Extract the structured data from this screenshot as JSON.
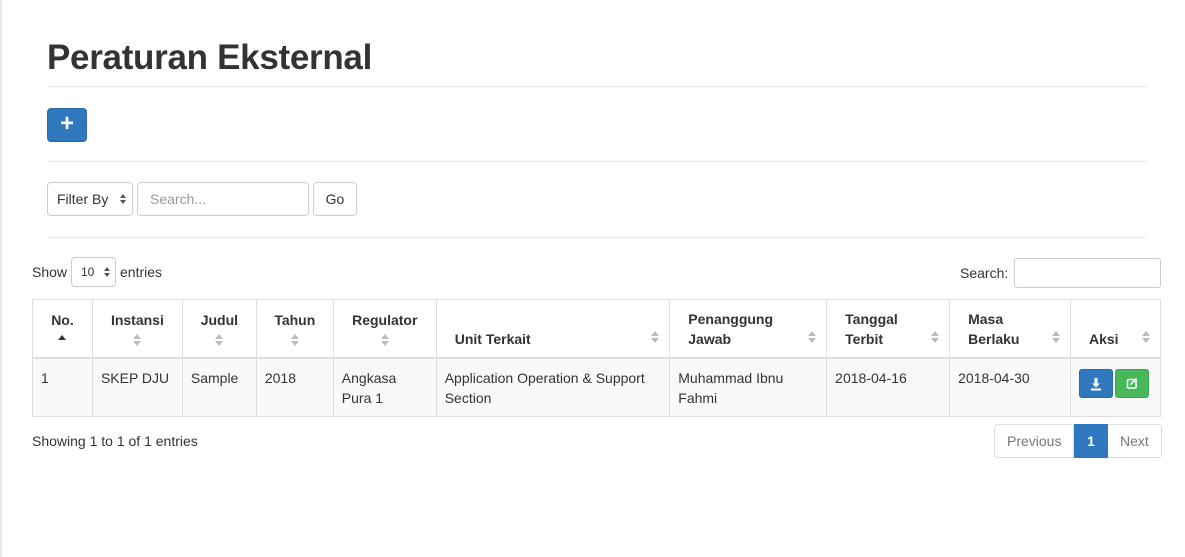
{
  "page": {
    "title": "Peraturan Eksternal"
  },
  "toolbar": {
    "add_label": "+"
  },
  "filter": {
    "select_label": "Filter By",
    "search_placeholder": "Search...",
    "go_label": "Go"
  },
  "datatable": {
    "show_label": "Show",
    "length_value": "10",
    "entries_label": "entries",
    "search_label": "Search:",
    "columns": [
      "No.",
      "Instansi",
      "Judul",
      "Tahun",
      "Regulator",
      "Unit Terkait",
      "Penanggung Jawab",
      "Tanggal Terbit",
      "Masa Berlaku",
      "Aksi"
    ],
    "rows": [
      {
        "no": "1",
        "instansi": "SKEP DJU",
        "judul": "Sample",
        "tahun": "2018",
        "regulator": "Angkasa Pura 1",
        "unit_terkait": "Application Operation & Support Section",
        "penanggung_jawab": "Muhammad Ibnu Fahmi",
        "tanggal_terbit": "2018-04-16",
        "masa_berlaku": "2018-04-30"
      }
    ],
    "info": "Showing 1 to 1 of 1 entries",
    "pagination": {
      "previous": "Previous",
      "current": "1",
      "next": "Next"
    }
  },
  "icons": {
    "download": "download-icon",
    "edit": "edit-icon"
  },
  "colors": {
    "primary": "#2f78be",
    "success": "#46b85a"
  }
}
